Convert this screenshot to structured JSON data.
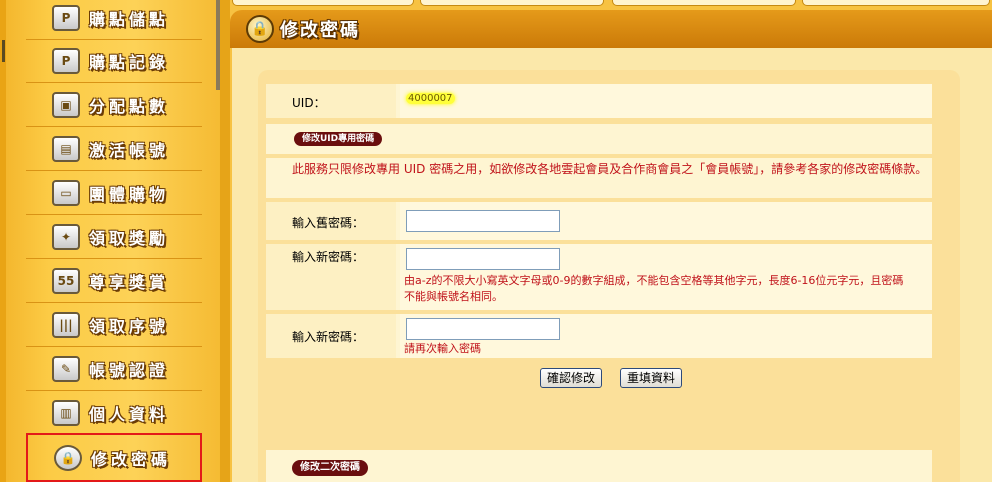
{
  "sidebar": {
    "items": [
      {
        "label": "購點儲點",
        "icon": "P"
      },
      {
        "label": "購點記錄",
        "icon": "P"
      },
      {
        "label": "分配點數",
        "icon": "▣"
      },
      {
        "label": "激活帳號",
        "icon": "▤"
      },
      {
        "label": "團體購物",
        "icon": "▭"
      },
      {
        "label": "領取獎勵",
        "icon": "✦"
      },
      {
        "label": "尊享獎賞",
        "icon": "55"
      },
      {
        "label": "領取序號",
        "icon": "|||"
      },
      {
        "label": "帳號認證",
        "icon": "✎"
      },
      {
        "label": "個人資料",
        "icon": "▥"
      },
      {
        "label": "修改密碼",
        "icon": "🔒"
      }
    ],
    "active_index": 10
  },
  "header": {
    "title": "修改密碼",
    "icon": "lock-icon"
  },
  "form": {
    "uid_label": "UID：",
    "uid_value": "4000007",
    "section_badge": "修改UID專用密碼",
    "notice": "此服務只限修改專用 UID 密碼之用，如欲修改各地雲起會員及合作商會員之「會員帳號」，請參考各家的修改密碼條款。",
    "old_password_label": "輸入舊密碼：",
    "new_password_label": "輸入新密碼：",
    "new_password_hint": "由a-z的不限大小寫英文字母或0-9的數字組成，不能包含空格等其他字元，長度6-16位元字元，且密碼不能與帳號名相同。",
    "confirm_password_label": "輸入新密碼：",
    "confirm_password_hint": "請再次輸入密碼",
    "old_password_value": "",
    "new_password_value": "",
    "confirm_password_value": "",
    "confirm_button": "確認修改",
    "reset_button": "重填資料",
    "second_section_badge": "修改二次密碼"
  },
  "colors": {
    "sidebar_bg": "#fdd257",
    "header_bg": "#d8870f",
    "notice_red": "#c0121a",
    "active_border": "#e31919"
  }
}
